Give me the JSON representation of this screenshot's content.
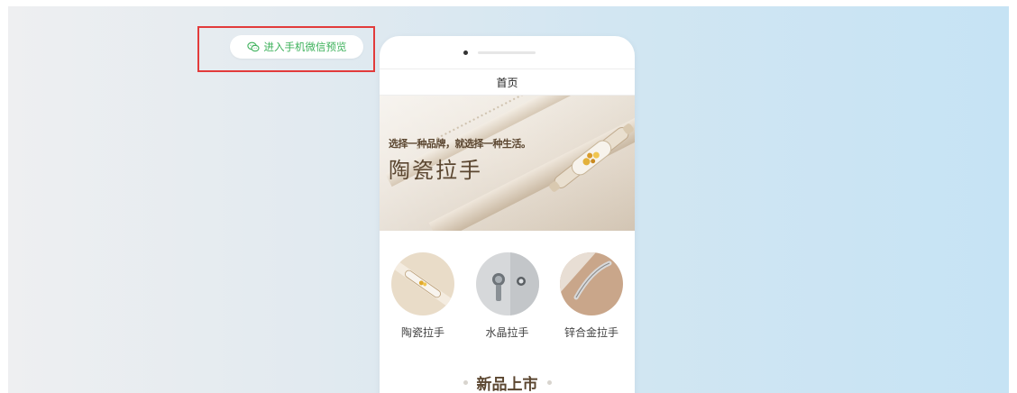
{
  "preview": {
    "label": "进入手机微信预览",
    "icon": "wechat-icon",
    "accent": "#3cb15a",
    "highlight_color": "#e23b3b"
  },
  "phone": {
    "nav_title": "首页",
    "banner": {
      "slogan": "选择一种品牌，就选择一种生活。",
      "title": "陶瓷拉手"
    },
    "categories": [
      {
        "label": "陶瓷拉手",
        "icon": "ceramic-handle-image"
      },
      {
        "label": "水晶拉手",
        "icon": "crystal-handle-image"
      },
      {
        "label": "锌合金拉手",
        "icon": "zinc-alloy-handle-image"
      }
    ],
    "section_title": "新品上市"
  }
}
